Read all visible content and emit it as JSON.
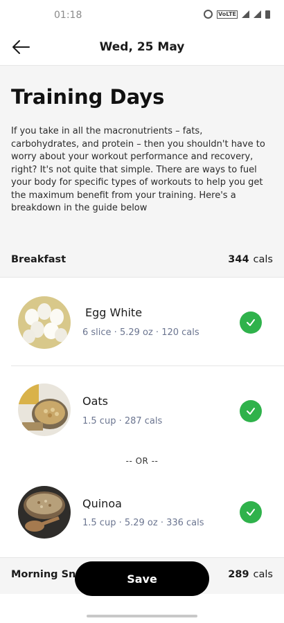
{
  "status_bar": {
    "time": "01:18",
    "icons": [
      "alarm-icon",
      "volte-icon",
      "signal-icon",
      "wifi-icon",
      "battery-icon"
    ]
  },
  "app_bar": {
    "title": "Wed, 25 May",
    "back_icon": "arrow-left-icon"
  },
  "intro": {
    "title": "Training Days",
    "body": "If you take in all the macronutrients – fats, carbohydrates, and protein – then you shouldn't have to worry about your workout performance and recovery, right? It's not quite that simple. There are ways to fuel your body for specific types of workouts to help you get the maximum benefit from your training. Here's a breakdown in the guide below"
  },
  "meals": [
    {
      "name": "Breakfast",
      "cals": "344",
      "unit": "cals",
      "items": [
        {
          "name": "Egg White",
          "meta": "6 slice · 5.29 oz · 120 cals",
          "checked": true
        },
        {
          "name": "Oats",
          "meta": "1.5 cup · 287 cals",
          "checked": true
        },
        {
          "name": "Quinoa",
          "meta": "1.5 cup · 5.29 oz · 336 cals",
          "checked": true
        }
      ],
      "or_label": "-- OR --"
    },
    {
      "name": "Morning Sn",
      "cals": "289",
      "unit": "cals"
    }
  ],
  "save_button": {
    "label": "Save"
  },
  "colors": {
    "accent_green": "#2fb24b",
    "section_bg": "#f5f5f5",
    "meta_text": "#6b7590",
    "button_bg": "#000000"
  }
}
